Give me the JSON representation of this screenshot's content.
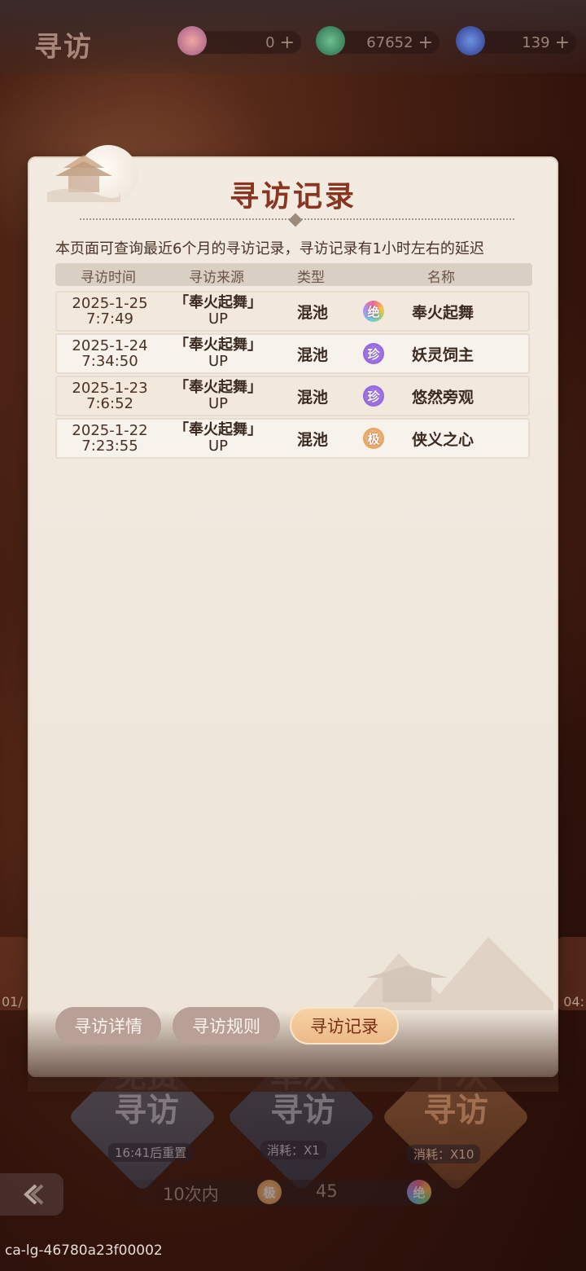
{
  "top_bar": {
    "title": "寻访",
    "resources": [
      {
        "icon": "peach-blossom-currency-icon",
        "value": "0",
        "plus": "+"
      },
      {
        "icon": "jade-currency-icon",
        "value": "67652",
        "plus": "+"
      },
      {
        "icon": "brush-ticket-icon",
        "value": "139",
        "plus": "+"
      }
    ]
  },
  "side": {
    "left_text": "01/",
    "right_text": "04:"
  },
  "panel": {
    "title": "寻访记录",
    "notice": "本页面可查询最近6个月的寻访记录，寻访记录有1小时左右的延迟",
    "columns": [
      "寻访时间",
      "寻访来源",
      "类型",
      "名称"
    ],
    "rows": [
      {
        "date": "2025-1-25",
        "time": "7:7:49",
        "source_line1": "「奉火起舞」",
        "source_line2": "UP",
        "type": "混池",
        "rarity": "绝",
        "rarity_class": "r-jue",
        "name": "奉火起舞"
      },
      {
        "date": "2025-1-24",
        "time": "7:34:50",
        "source_line1": "「奉火起舞」",
        "source_line2": "UP",
        "type": "混池",
        "rarity": "珍",
        "rarity_class": "r-zhen",
        "name": "妖灵饲主"
      },
      {
        "date": "2025-1-23",
        "time": "7:6:52",
        "source_line1": "「奉火起舞」",
        "source_line2": "UP",
        "type": "混池",
        "rarity": "珍",
        "rarity_class": "r-zhen",
        "name": "悠然旁观"
      },
      {
        "date": "2025-1-22",
        "time": "7:23:55",
        "source_line1": "「奉火起舞」",
        "source_line2": "UP",
        "type": "混池",
        "rarity": "极",
        "rarity_class": "r-ji",
        "name": "侠义之心"
      }
    ]
  },
  "tabs": [
    {
      "label": "寻访详情",
      "active": false
    },
    {
      "label": "寻访规则",
      "active": false
    },
    {
      "label": "寻访记录",
      "active": true
    }
  ],
  "actions": [
    {
      "label_line1": "免费",
      "label_line2": "寻访",
      "sub": "16:41后重置"
    },
    {
      "label_line1": "单次",
      "label_line2": "寻访",
      "sub": "消耗：X1"
    },
    {
      "label_line1": "十次",
      "label_line2": "寻访",
      "sub": "消耗：X10"
    }
  ],
  "pity": {
    "text1": "10次内",
    "badge1": "极",
    "text2": "45",
    "badge2": "绝"
  },
  "footer_id": "ca-lg-46780a23f00002",
  "colors": {
    "title": "#8a3520",
    "active_tab": "#ecb886",
    "panel_bg": "#efe6db"
  }
}
